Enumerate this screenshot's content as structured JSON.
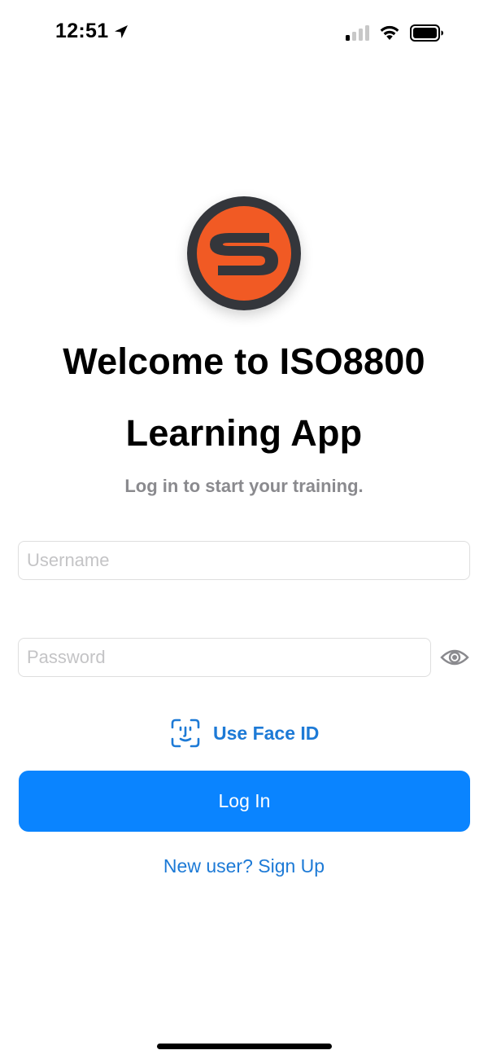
{
  "status_bar": {
    "time": "12:51",
    "location_icon": "location-arrow-icon",
    "signal_icon": "cellular-signal-icon",
    "wifi_icon": "wifi-icon",
    "battery_icon": "battery-icon"
  },
  "logo": {
    "icon": "app-logo-s-icon",
    "colors": {
      "ring": "#34363b",
      "fill": "#f15a24",
      "letter": "#34363b"
    }
  },
  "header": {
    "title_line1": "Welcome to ISO8800",
    "title_line2": "Learning App",
    "subtitle": "Log in to start your training."
  },
  "form": {
    "username_placeholder": "Username",
    "password_placeholder": "Password",
    "password_toggle_icon": "eye-icon",
    "faceid_icon": "face-id-icon",
    "faceid_label": "Use Face ID",
    "login_label": "Log In",
    "signup_label": "New user? Sign Up"
  },
  "colors": {
    "accent": "#0a84ff",
    "link": "#1d7ad6",
    "subtitle": "#8a8a8e"
  }
}
